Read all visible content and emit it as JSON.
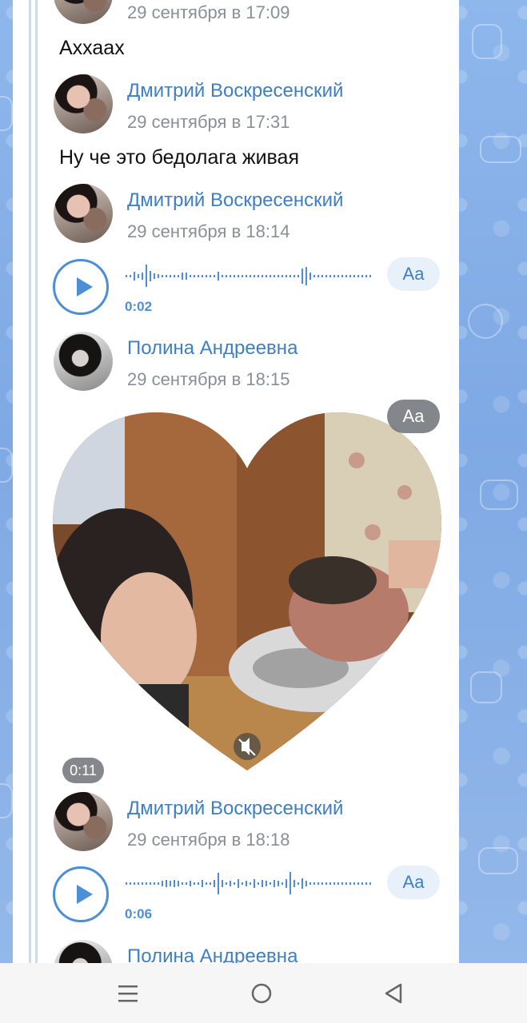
{
  "messages": [
    {
      "type": "header_tail",
      "time": "29 сентября в 17:09"
    },
    {
      "type": "text",
      "text": "Аххаах"
    },
    {
      "type": "header",
      "name": "Дмитрий Воскресенский",
      "time": "29 сентября в 17:31",
      "avatar": "avatar-dmitry"
    },
    {
      "type": "text",
      "text": "Ну че это бедолага живая"
    },
    {
      "type": "header",
      "name": "Дмитрий Воскресенский",
      "time": "29 сентября в 18:14",
      "avatar": "avatar-dmitry"
    },
    {
      "type": "voice",
      "duration": "0:02",
      "transcribe_label": "Aa"
    },
    {
      "type": "header",
      "name": "Полина Андреевна",
      "time": "29 сентября в 18:15",
      "avatar": "avatar-polina"
    },
    {
      "type": "video_note",
      "duration": "0:11",
      "transcribe_label": "Aa",
      "mask": "heart",
      "muted_icon": "mute-icon"
    },
    {
      "type": "header",
      "name": "Дмитрий Воскресенский",
      "time": "29 сентября в 18:18",
      "avatar": "avatar-dmitry"
    },
    {
      "type": "voice",
      "duration": "0:06",
      "transcribe_label": "Aa"
    },
    {
      "type": "header",
      "name": "Полина Андреевна",
      "avatar": "avatar-polina"
    }
  ],
  "nav": {
    "menu_icon": "menu-icon",
    "home_icon": "home-circle-icon",
    "back_icon": "back-triangle-icon"
  },
  "colors": {
    "accent": "#3e7fc3",
    "play": "#4c8fd8",
    "time": "#8a8f96"
  }
}
